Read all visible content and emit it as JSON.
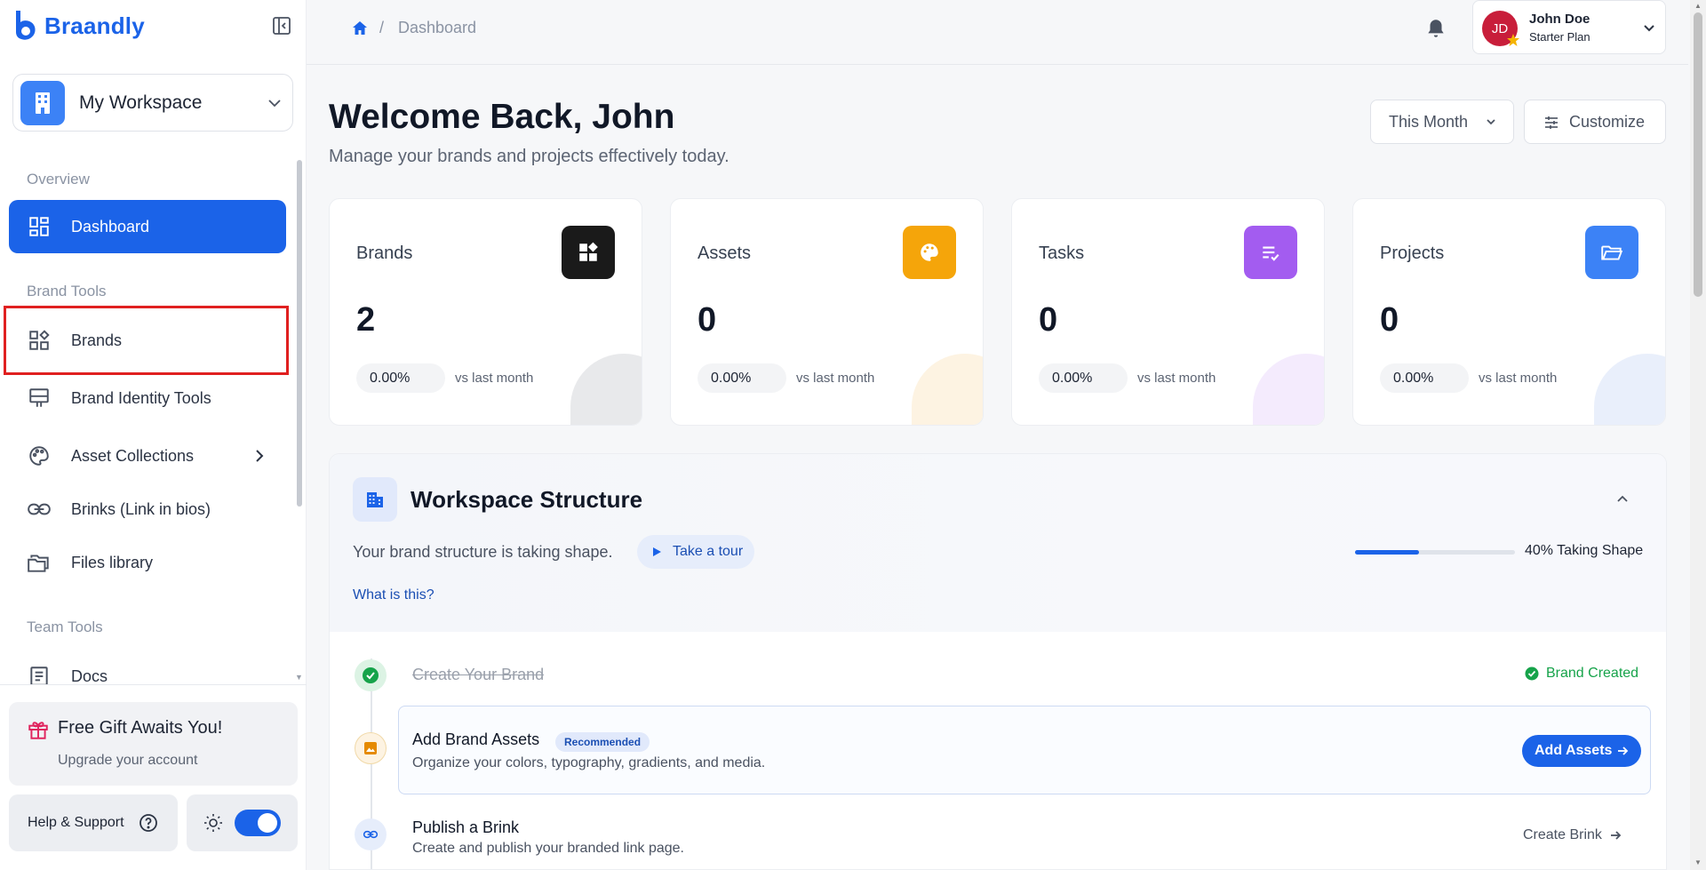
{
  "app": {
    "name": "Braandly"
  },
  "workspace": {
    "label": "My Workspace"
  },
  "sidebar": {
    "sections": {
      "overview": "Overview",
      "brand_tools": "Brand Tools",
      "team_tools": "Team Tools"
    },
    "items": [
      {
        "label": "Dashboard",
        "icon": "dashboard-icon",
        "active": true
      },
      {
        "label": "Brands",
        "icon": "brands-icon"
      },
      {
        "label": "Brand Identity Tools",
        "icon": "identity-icon"
      },
      {
        "label": "Asset Collections",
        "icon": "palette-icon"
      },
      {
        "label": "Brinks (Link in bios)",
        "icon": "link-icon"
      },
      {
        "label": "Files library",
        "icon": "folders-icon"
      },
      {
        "label": "Docs",
        "icon": "docs-icon"
      }
    ],
    "gift": {
      "title": "Free Gift Awaits You!",
      "subtitle": "Upgrade your account"
    },
    "help_label": "Help & Support",
    "theme_toggle_on": true
  },
  "breadcrumb": {
    "current": "Dashboard",
    "separator": "/"
  },
  "user": {
    "initials": "JD",
    "name": "John Doe",
    "plan": "Starter Plan"
  },
  "header": {
    "title": "Welcome Back, John",
    "subtitle": "Manage your brands and projects effectively today.",
    "period": "This Month",
    "customize": "Customize"
  },
  "stats": [
    {
      "label": "Brands",
      "value": "2",
      "change": "0.00%",
      "vs": "vs last month",
      "color": "#1a1a1a"
    },
    {
      "label": "Assets",
      "value": "0",
      "change": "0.00%",
      "vs": "vs last month",
      "color": "#f5a50a"
    },
    {
      "label": "Tasks",
      "value": "0",
      "change": "0.00%",
      "vs": "vs last month",
      "color": "#a35cf0"
    },
    {
      "label": "Projects",
      "value": "0",
      "change": "0.00%",
      "vs": "vs last month",
      "color": "#3c82f6"
    }
  ],
  "structure": {
    "title": "Workspace Structure",
    "description": "Your brand structure is taking shape.",
    "tour_label": "Take a tour",
    "what_link": "What is this?",
    "progress": 0.4,
    "progress_label": "40% Taking Shape",
    "steps": [
      {
        "title": "Create Your Brand",
        "status_label": "Brand Created"
      },
      {
        "title": "Add Brand Assets",
        "badge": "Recommended",
        "desc": "Organize your colors, typography, gradients, and media.",
        "action": "Add Assets"
      },
      {
        "title": "Publish a Brink",
        "desc": "Create and publish your branded link page.",
        "action": "Create Brink"
      }
    ]
  },
  "colors": {
    "accent": "#1b63e8",
    "success": "#16a34a",
    "avatar": "#c81e3a"
  }
}
